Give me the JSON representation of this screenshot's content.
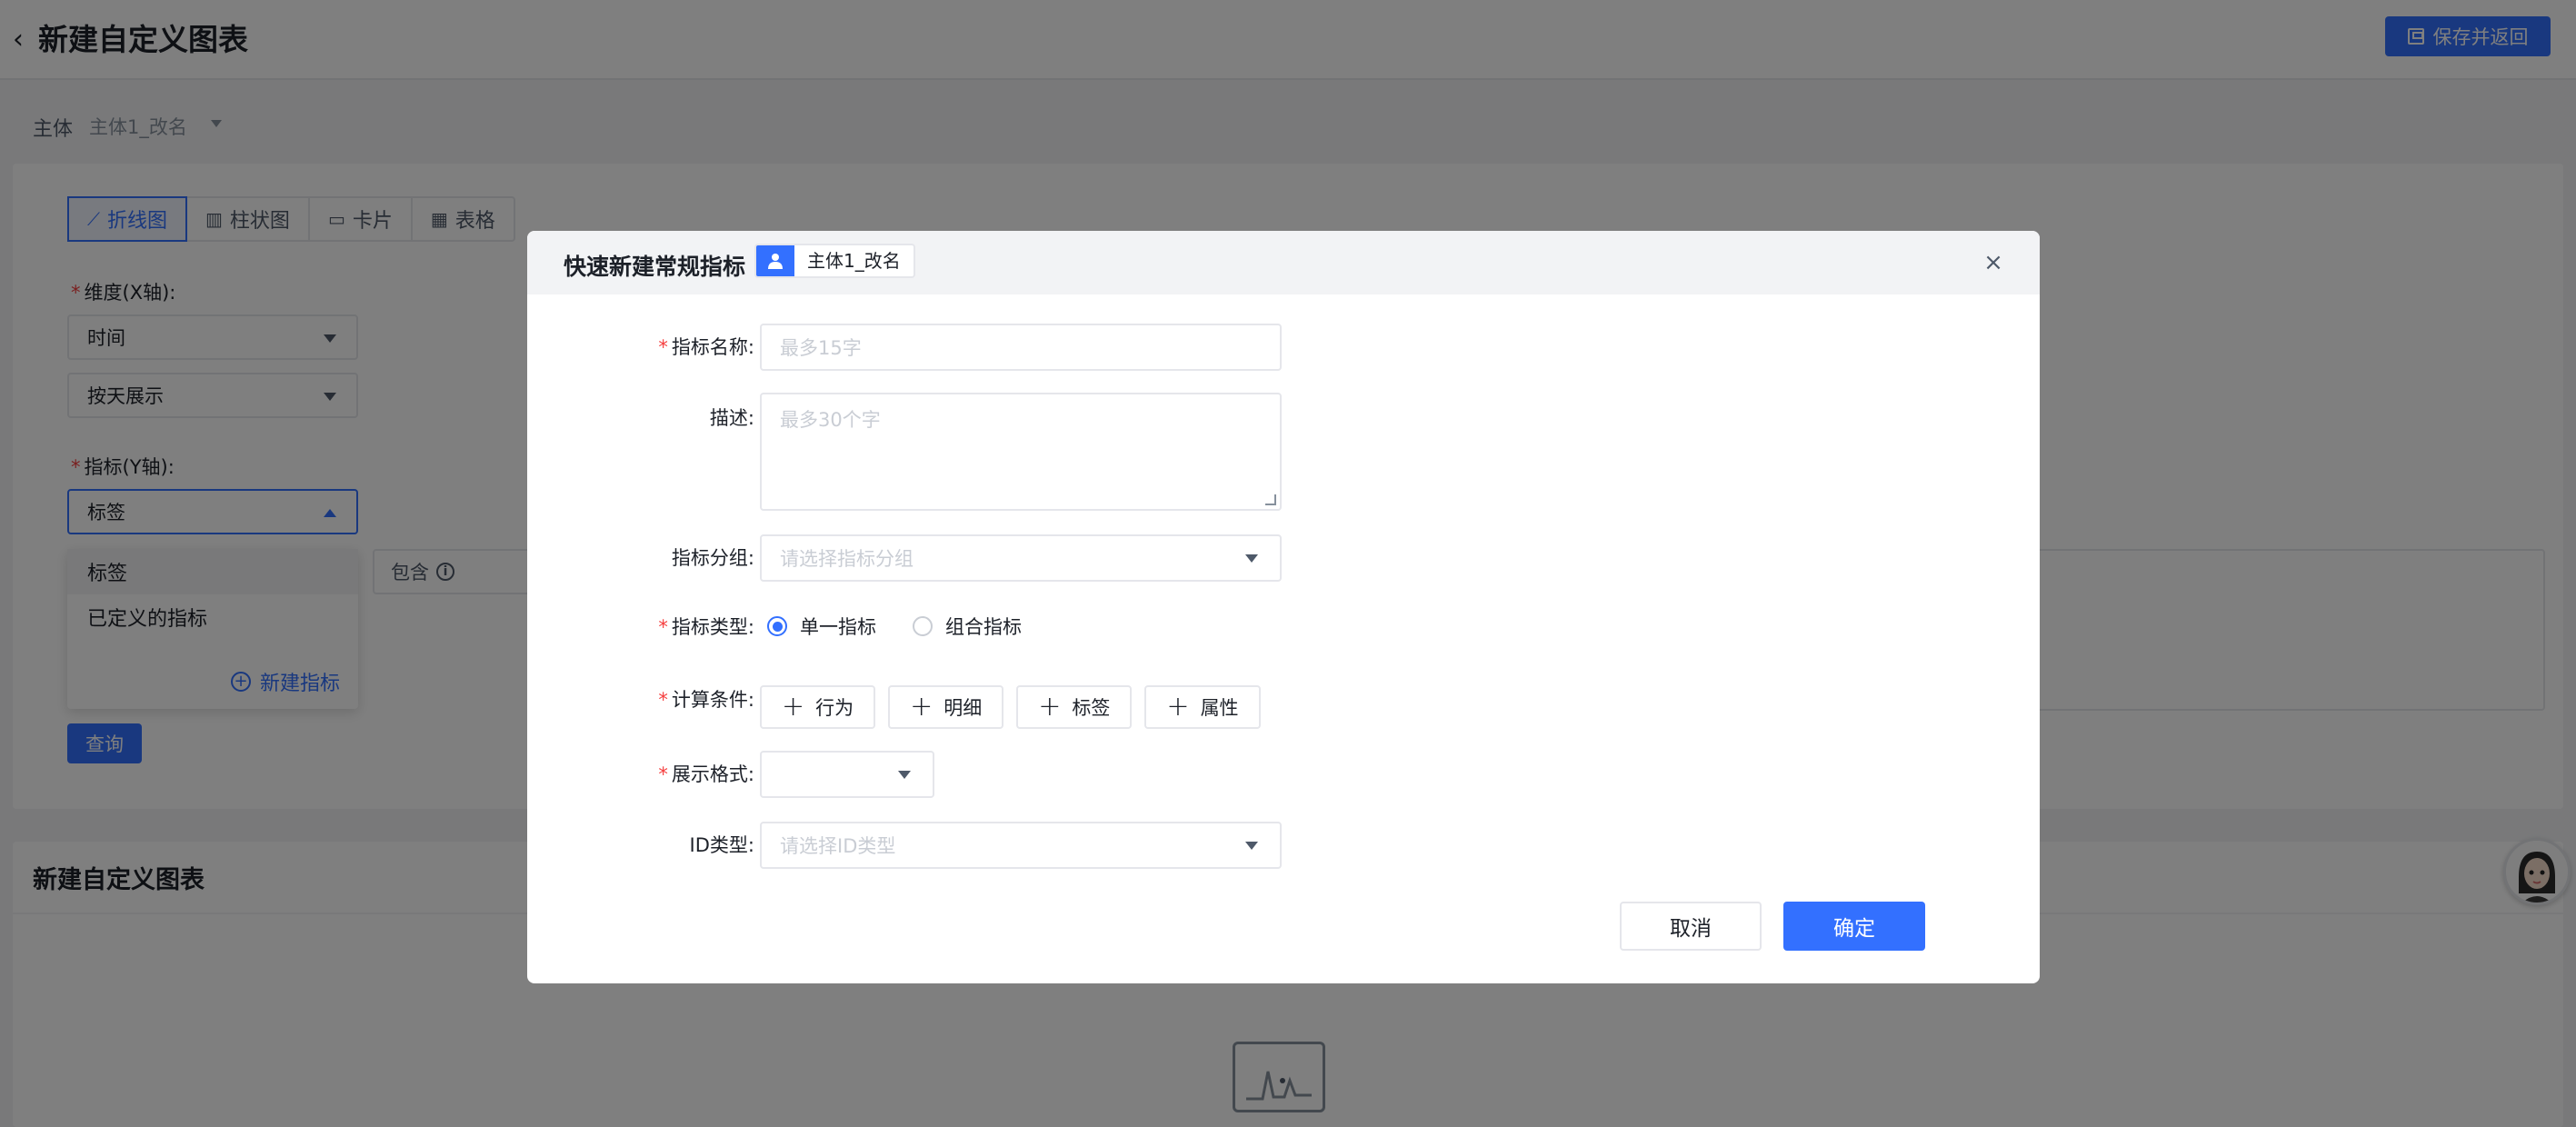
{
  "header": {
    "title": "新建自定义图表",
    "save_return": "保存并返回"
  },
  "subject": {
    "label": "主体",
    "value": "主体1_改名"
  },
  "chart_tabs": [
    {
      "label": "折线图",
      "glyph": "📈",
      "active": true
    },
    {
      "label": "柱状图",
      "glyph": "📊",
      "active": false
    },
    {
      "label": "卡片",
      "glyph": "▭",
      "active": false
    },
    {
      "label": "表格",
      "glyph": "▦",
      "active": false
    }
  ],
  "dimension": {
    "label": "维度(X轴):",
    "value": "时间",
    "granularity": "按天展示"
  },
  "metric": {
    "label": "指标(Y轴):",
    "value": "标签"
  },
  "metric_dropdown": {
    "items": [
      "标签",
      "已定义的指标"
    ],
    "new_label": "新建指标"
  },
  "filter": {
    "contains_label": "包含"
  },
  "query_button": "查询",
  "chart_card": {
    "title": "新建自定义图表"
  },
  "modal": {
    "title": "快速新建常规指标",
    "subject_tag": "主体1_改名",
    "fields": {
      "name": {
        "label": "指标名称:",
        "placeholder": "最多15字"
      },
      "desc": {
        "label": "描述:",
        "placeholder": "最多30个字"
      },
      "group": {
        "label": "指标分组:",
        "placeholder": "请选择指标分组"
      },
      "type": {
        "label": "指标类型:",
        "options": [
          "单一指标",
          "组合指标"
        ],
        "selected": "单一指标"
      },
      "condition": {
        "label": "计算条件:",
        "buttons": [
          "行为",
          "明细",
          "标签",
          "属性"
        ]
      },
      "format": {
        "label": "展示格式:",
        "value": ""
      },
      "id_type": {
        "label": "ID类型:",
        "placeholder": "请选择ID类型"
      }
    },
    "cancel": "取消",
    "confirm": "确定"
  },
  "colors": {
    "primary": "#3370ff",
    "required": "#f53f3f",
    "mask": "rgba(0,0,0,0.5)"
  }
}
